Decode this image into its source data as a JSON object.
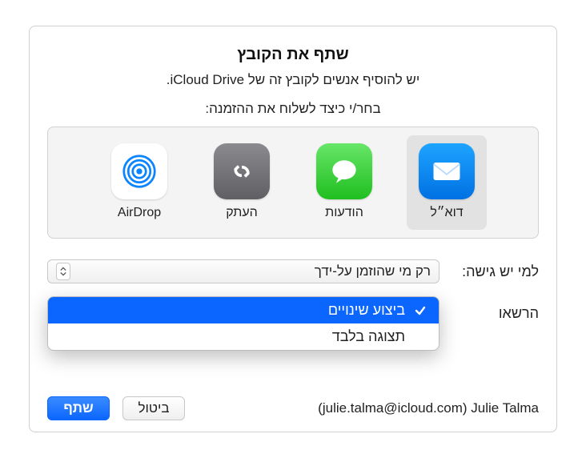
{
  "title": "שתף את הקובץ",
  "subtitle": "יש להוסיף אנשים לקובץ זה של iCloud Drive.",
  "instruction": "בחר/י כיצד לשלוח את ההזמנה:",
  "methods": {
    "mail": "דוא״ל",
    "messages": "הודעות",
    "copy": "העתק",
    "airdrop": "AirDrop"
  },
  "access": {
    "label": "למי יש גישה:",
    "value": "רק מי שהוזמן על-ידך"
  },
  "permission": {
    "label": "הרשאו",
    "options": {
      "make_changes": "ביצוע שינויים",
      "view_only": "תצוגה בלבד"
    }
  },
  "footer": {
    "user": "(julie.talma@icloud.com) Julie Talma",
    "cancel": "ביטול",
    "share": "שתף"
  }
}
